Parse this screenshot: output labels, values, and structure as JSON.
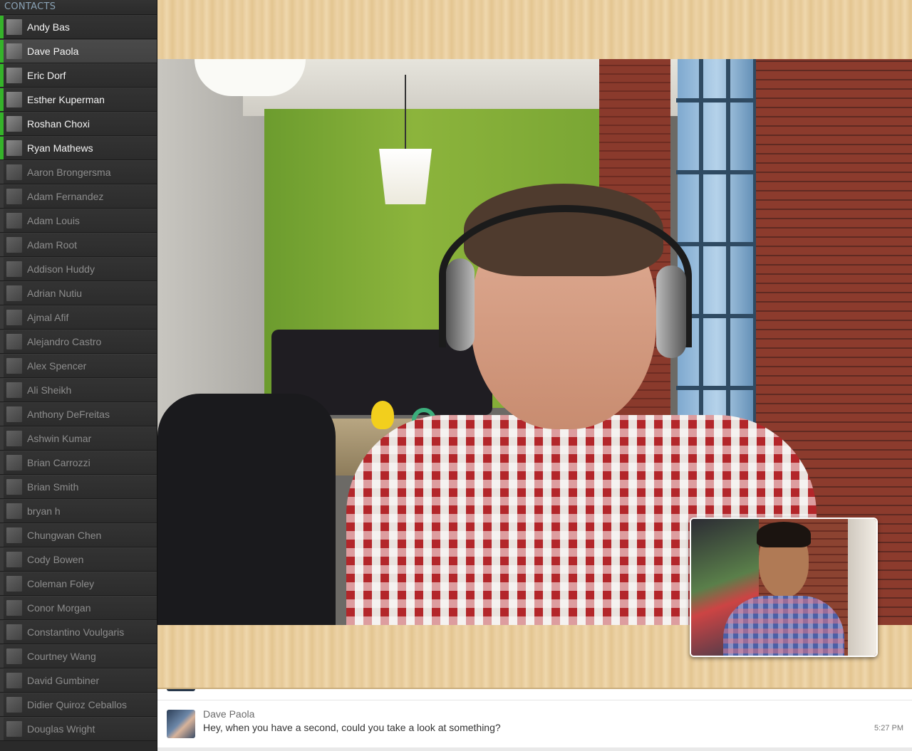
{
  "sidebar": {
    "header": "CONTACTS",
    "contacts": [
      {
        "name": "Andy Bas",
        "status": "online",
        "avatar_icon": "contact-avatar"
      },
      {
        "name": "Dave Paola",
        "status": "online",
        "selected": true,
        "avatar_icon": "contact-avatar"
      },
      {
        "name": "Eric Dorf",
        "status": "online",
        "avatar_icon": "contact-avatar"
      },
      {
        "name": "Esther Kuperman",
        "status": "online",
        "avatar_icon": "contact-avatar"
      },
      {
        "name": "Roshan Choxi",
        "status": "online",
        "avatar_icon": "contact-avatar"
      },
      {
        "name": "Ryan Mathews",
        "status": "online",
        "avatar_icon": "contact-avatar"
      },
      {
        "name": "Aaron Brongersma",
        "status": "offline",
        "avatar_icon": "contact-avatar"
      },
      {
        "name": "Adam Fernandez",
        "status": "offline",
        "avatar_icon": "contact-avatar"
      },
      {
        "name": "Adam Louis",
        "status": "offline",
        "avatar_icon": "contact-avatar"
      },
      {
        "name": "Adam Root",
        "status": "offline",
        "avatar_icon": "contact-avatar"
      },
      {
        "name": "Addison Huddy",
        "status": "offline",
        "avatar_icon": "contact-avatar"
      },
      {
        "name": "Adrian Nutiu",
        "status": "offline",
        "avatar_icon": "contact-avatar"
      },
      {
        "name": "Ajmal Afif",
        "status": "offline",
        "avatar_icon": "contact-avatar"
      },
      {
        "name": "Alejandro Castro",
        "status": "offline",
        "avatar_icon": "contact-avatar"
      },
      {
        "name": "Alex Spencer",
        "status": "offline",
        "avatar_icon": "contact-avatar"
      },
      {
        "name": "Ali Sheikh",
        "status": "offline",
        "avatar_icon": "contact-avatar"
      },
      {
        "name": "Anthony DeFreitas",
        "status": "offline",
        "avatar_icon": "contact-avatar"
      },
      {
        "name": "Ashwin Kumar",
        "status": "offline",
        "avatar_icon": "contact-avatar"
      },
      {
        "name": "Brian Carrozzi",
        "status": "offline",
        "avatar_icon": "contact-avatar"
      },
      {
        "name": "Brian Smith",
        "status": "offline",
        "avatar_icon": "contact-avatar"
      },
      {
        "name": "bryan h",
        "status": "offline",
        "avatar_icon": "contact-avatar"
      },
      {
        "name": "Chungwan Chen",
        "status": "offline",
        "avatar_icon": "contact-avatar"
      },
      {
        "name": "Cody Bowen",
        "status": "offline",
        "avatar_icon": "contact-avatar"
      },
      {
        "name": "Coleman Foley",
        "status": "offline",
        "avatar_icon": "contact-avatar"
      },
      {
        "name": "Conor Morgan",
        "status": "offline",
        "avatar_icon": "contact-avatar"
      },
      {
        "name": "Constantino Voulgaris",
        "status": "offline",
        "avatar_icon": "contact-avatar"
      },
      {
        "name": "Courtney Wang",
        "status": "offline",
        "avatar_icon": "contact-avatar"
      },
      {
        "name": "David Gumbiner",
        "status": "offline",
        "avatar_icon": "contact-avatar"
      },
      {
        "name": "Didier Quiroz Ceballos",
        "status": "offline",
        "avatar_icon": "contact-avatar"
      },
      {
        "name": "Douglas Wright",
        "status": "offline",
        "avatar_icon": "contact-avatar"
      }
    ]
  },
  "colors": {
    "online_indicator": "#35b32a",
    "sidebar_bg": "#2a2a2a",
    "wood": "#ecd2a6"
  },
  "chat": {
    "messages": [
      {
        "sender": "Dave Paola",
        "text": "Hey, when you have a second, could you take a look at something?",
        "time": "5:27 PM"
      }
    ]
  }
}
